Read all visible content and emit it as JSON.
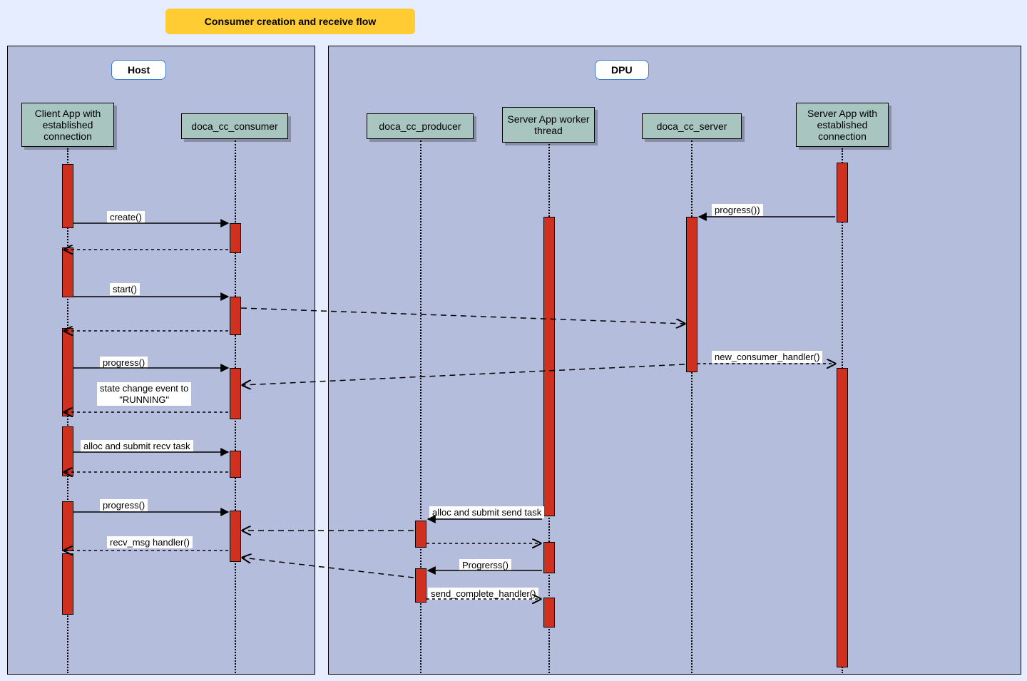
{
  "title": "Consumer creation and receive flow",
  "groups": {
    "host": "Host",
    "dpu": "DPU"
  },
  "participants": {
    "client_app": "Client App with established connection",
    "consumer": "doca_cc_consumer",
    "producer": "doca_cc_producer",
    "worker": "Server App worker thread",
    "server": "doca_cc_server",
    "server_app": "Server App with established connection"
  },
  "messages": {
    "create": "create()",
    "start": "start()",
    "progress1": "progress()",
    "state_change": "state change event to \"RUNNING\"",
    "alloc_recv": "alloc and submit recv task",
    "progress2": "progress()",
    "recv_msg": "recv_msg handler()",
    "progress_right": "progress())",
    "new_consumer": "new_consumer_handler()",
    "alloc_send": "alloc and submit send task",
    "progrerss": "Progrerss()",
    "send_complete": "send_complete_handler()"
  }
}
